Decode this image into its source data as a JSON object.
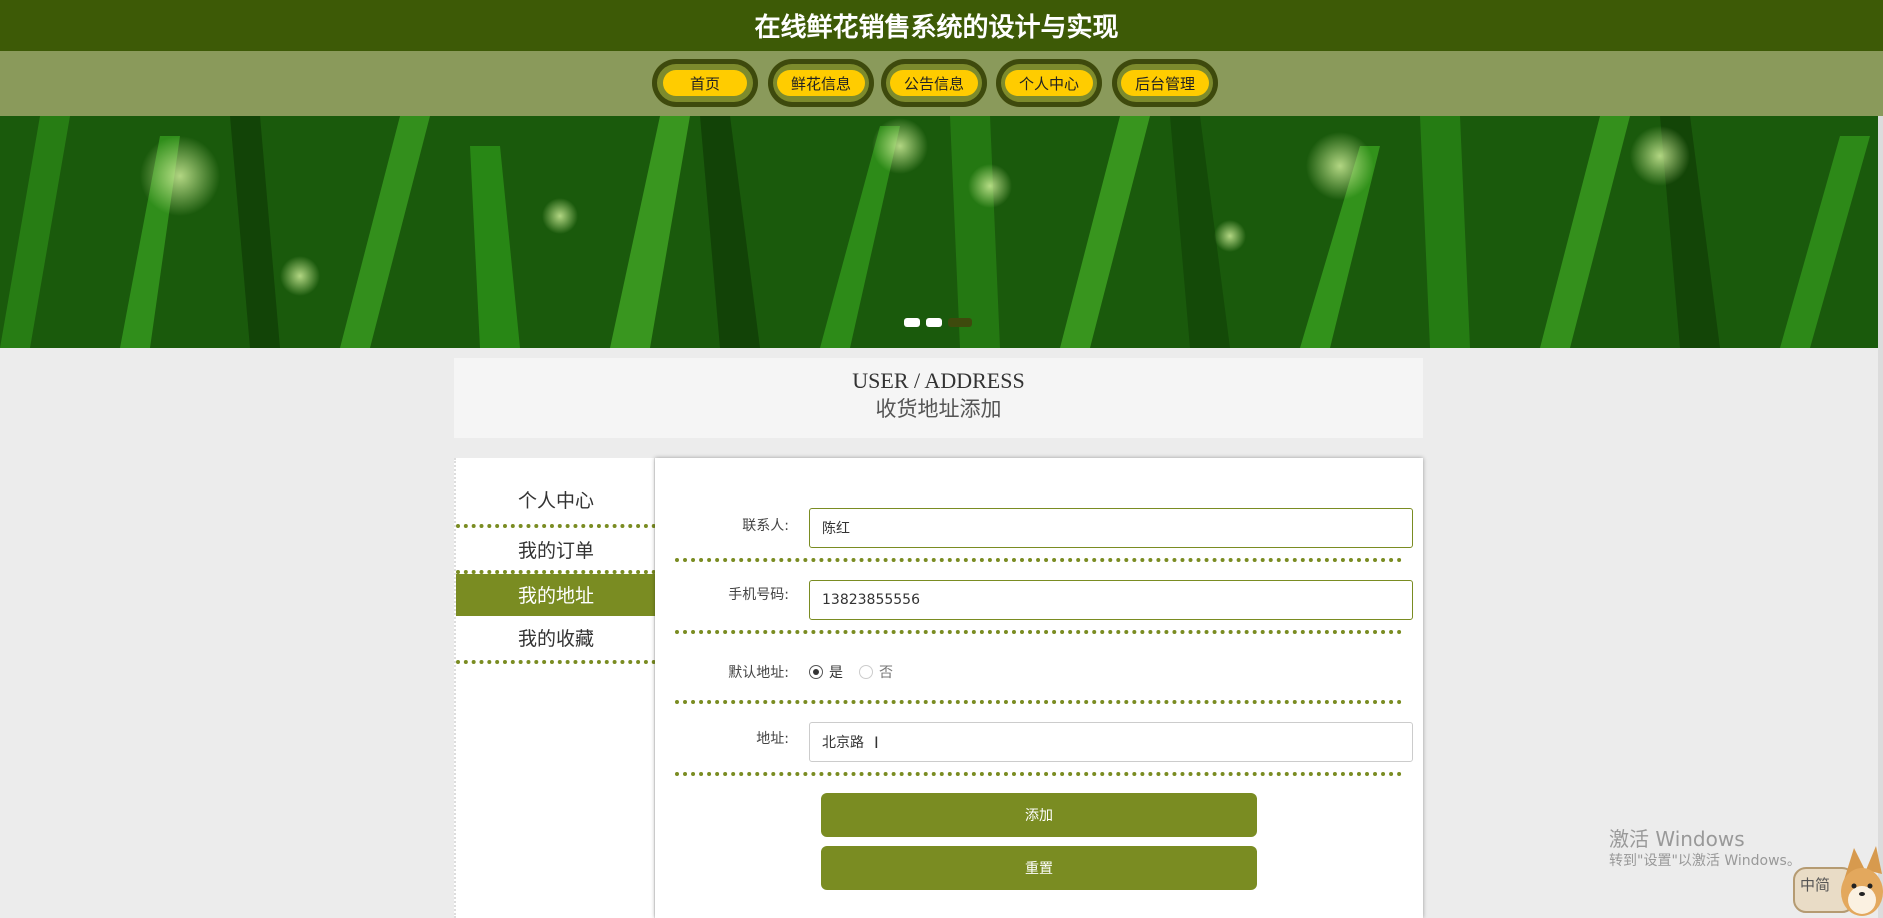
{
  "header": {
    "title": "在线鲜花销售系统的设计与实现"
  },
  "nav": {
    "items": [
      {
        "label": "首页"
      },
      {
        "label": "鲜花信息"
      },
      {
        "label": "公告信息"
      },
      {
        "label": "个人中心"
      },
      {
        "label": "后台管理"
      }
    ]
  },
  "banner": {
    "dot_count": 3,
    "active_dot": 3
  },
  "page_heading": {
    "english": "USER / ADDRESS",
    "chinese": "收货地址添加"
  },
  "sidebar": {
    "items": [
      {
        "label": "个人中心",
        "active": false
      },
      {
        "label": "我的订单",
        "active": false
      },
      {
        "label": "我的地址",
        "active": true
      },
      {
        "label": "我的收藏",
        "active": false
      }
    ]
  },
  "form": {
    "contact_label": "联系人:",
    "contact_value": "陈红",
    "phone_label": "手机号码:",
    "phone_value": "13823855556",
    "default_label": "默认地址:",
    "default_yes": "是",
    "default_no": "否",
    "default_selected": "是",
    "address_label": "地址:",
    "address_value": "北京路",
    "add_button": "添加",
    "reset_button": "重置"
  },
  "watermark": {
    "title": "激活 Windows",
    "subtitle": "转到\"设置\"以激活 Windows。"
  },
  "ime": {
    "label": "中简"
  },
  "colors": {
    "header_bg": "#3d5a06",
    "nav_bg": "#8a9a5b",
    "accent": "#7a8c22",
    "nav_pill": "#ffcc00"
  }
}
